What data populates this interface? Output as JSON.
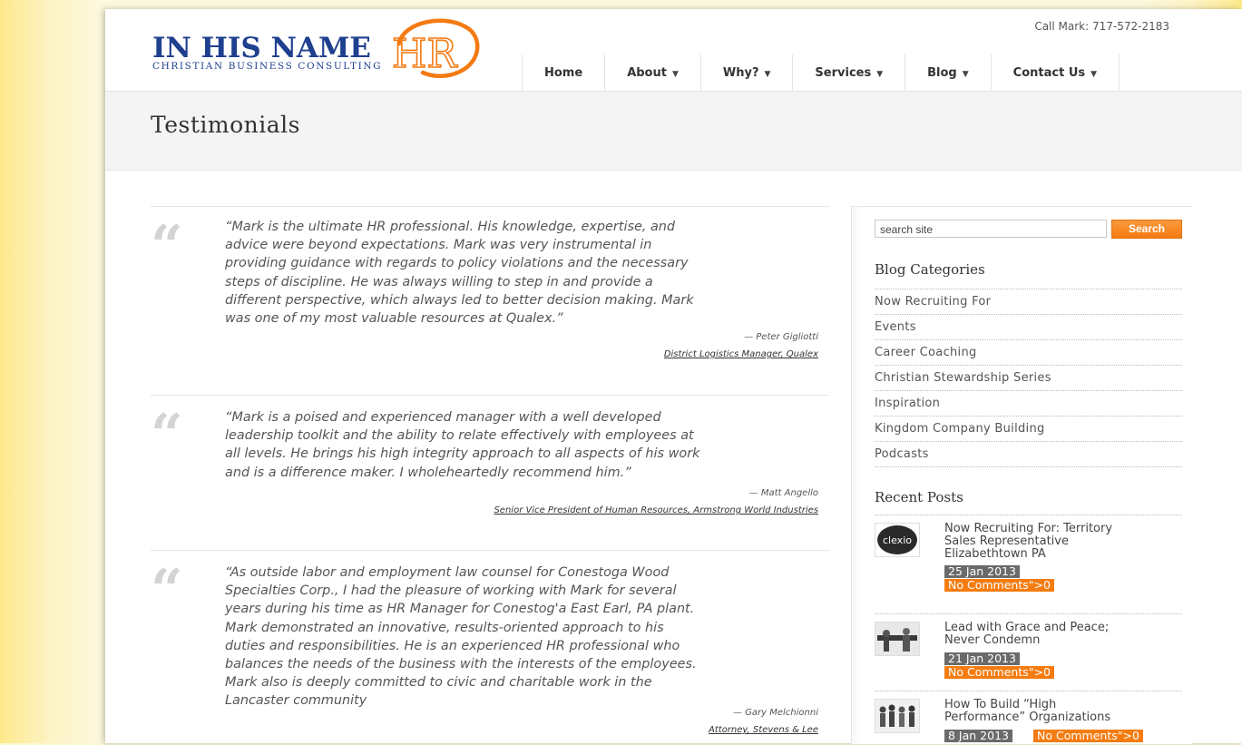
{
  "header": {
    "logo_main": "IN HIS NAME",
    "logo_sub": "CHRISTIAN BUSINESS CONSULTING",
    "logo_mark": "HR",
    "call": "Call Mark: 717-572-2183"
  },
  "nav": {
    "items": [
      {
        "label": "Home",
        "dropdown": false
      },
      {
        "label": "About",
        "dropdown": true
      },
      {
        "label": "Why?",
        "dropdown": true
      },
      {
        "label": "Services",
        "dropdown": true
      },
      {
        "label": "Blog",
        "dropdown": true
      },
      {
        "label": "Contact Us",
        "dropdown": true
      }
    ]
  },
  "page": {
    "title": "Testimonials"
  },
  "testimonials": [
    {
      "lines": [
        "“Mark is the ultimate HR professional. His knowledge, expertise, and",
        "advice were beyond expectations. Mark was very instrumental in",
        "providing guidance with regards to policy violations and the necessary",
        "steps of discipline. He was always willing to step in and provide a",
        "different perspective, which always led to better decision making. Mark",
        "was one of my most valuable resources at Qualex.”"
      ],
      "author": "— Peter Gigliotti",
      "role": "District Logistics Manager, Qualex"
    },
    {
      "lines": [
        "“Mark is a poised and experienced manager with a well developed",
        "leadership toolkit and the ability to relate effectively with employees at",
        "all levels. He brings his high integrity approach to all aspects of his work",
        "and is a difference maker. I wholeheartedly recommend him.”"
      ],
      "author": "— Matt Angello",
      "role": "Senior Vice President of Human Resources, Armstrong World Industries"
    },
    {
      "lines": [
        "“As outside labor and employment law counsel for Conestoga Wood",
        "Specialties Corp., I had the pleasure of working with Mark for several",
        "years during his time as HR Manager for Conestog'a East Earl, PA plant.",
        "Mark demonstrated an innovative, results-oriented approach to his",
        "duties and responsibilities. He is an experienced HR professional who",
        "balances the needs of the business with the interests of the employees.",
        "Mark also is deeply committed to civic and charitable work in the",
        "Lancaster community"
      ],
      "author": "— Gary Melchionni",
      "role": "Attorney, Stevens & Lee"
    }
  ],
  "sidebar": {
    "search_placeholder": "search site",
    "search_button": "Search",
    "categories_heading": "Blog Categories",
    "categories": [
      "Now Recruiting For",
      "Events",
      "Career Coaching",
      "Christian Stewardship Series",
      "Inspiration",
      "Kingdom Company Building",
      "Podcasts"
    ],
    "recent_heading": "Recent Posts",
    "recent_posts": [
      {
        "title_lines": [
          "Now Recruiting For: Territory",
          "Sales Representative",
          "Elizabethtown PA"
        ],
        "date": "25 Jan 2013",
        "comments": "No Comments\">0",
        "thumb_label": "clexio"
      },
      {
        "title_lines": [
          "Lead with Grace and Peace;",
          "Never Condemn"
        ],
        "date": "21 Jan 2013",
        "comments": "No Comments\">0"
      },
      {
        "title_lines": [
          "How To Build “High",
          "Performance” Organizations"
        ],
        "date": "8 Jan 2013",
        "comments": "No Comments\">0"
      }
    ]
  },
  "colors": {
    "brand_blue": "#1f3f8f",
    "accent_orange": "#f57c10",
    "date_gray": "#6a6a6a"
  }
}
